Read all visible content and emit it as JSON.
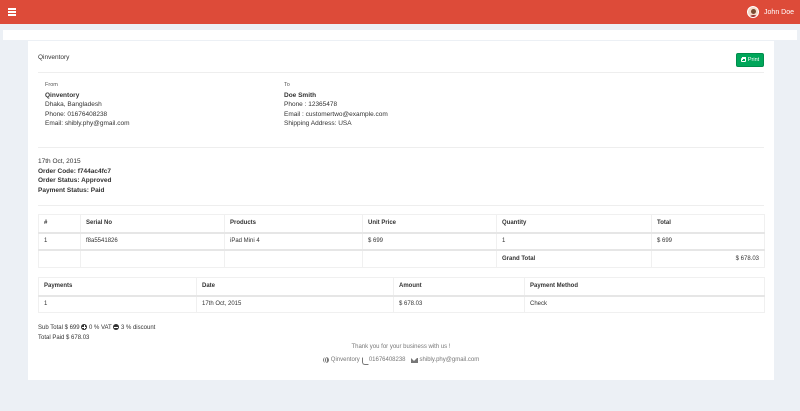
{
  "topbar": {
    "username": "John Doe"
  },
  "invoice": {
    "brand": "Qinventory",
    "print_label": "Print",
    "from": {
      "label": "From",
      "name": "Qinventory",
      "address": "Dhaka, Bangladesh",
      "phone": "Phone: 01676408238",
      "email": "Email: shibly.phy@gmail.com"
    },
    "to": {
      "label": "To",
      "name": "Doe Smith",
      "phone": "Phone : 12365478",
      "email": "Email : customertwo@example.com",
      "shipping": "Shipping Address: USA"
    },
    "date": "17th Oct, 2015",
    "order_code": "Order Code: f744ac4fc7",
    "order_status": "Order Status: Approved",
    "payment_status": "Payment Status: Paid"
  },
  "items_table": {
    "headers": [
      "#",
      "Serial No",
      "Products",
      "Unit Price",
      "Quantity",
      "Total"
    ],
    "rows": [
      [
        "1",
        "f8a5541826",
        "iPad Mini 4",
        "$ 699",
        "1",
        "$ 699"
      ]
    ],
    "grand_total_label": "Grand Total",
    "grand_total_value": "$ 678.03"
  },
  "payments_table": {
    "headers": [
      "Payments",
      "Date",
      "Amount",
      "Payment Method"
    ],
    "rows": [
      [
        "1",
        "17th Oct, 2015",
        "$ 678.03",
        "Check"
      ]
    ]
  },
  "summary": {
    "sub_total": "Sub Total $ 699",
    "vat": "0 % VAT",
    "discount": "3 % discount",
    "total_paid": "Total Paid $ 678.03"
  },
  "footer": {
    "thanks": "Thank you for your business with us !",
    "company": "Qinventory",
    "phone": "01676408238",
    "email": "shibly.phy@gmail.com"
  },
  "colors": {
    "topbar": "#dd4b39",
    "print_button": "#00a65a",
    "background": "#ecf0f5"
  },
  "icons": [
    "menu-icon",
    "avatar",
    "print-icon",
    "plus-circle-icon",
    "minus-circle-icon",
    "globe-icon",
    "phone-icon",
    "envelope-icon"
  ]
}
